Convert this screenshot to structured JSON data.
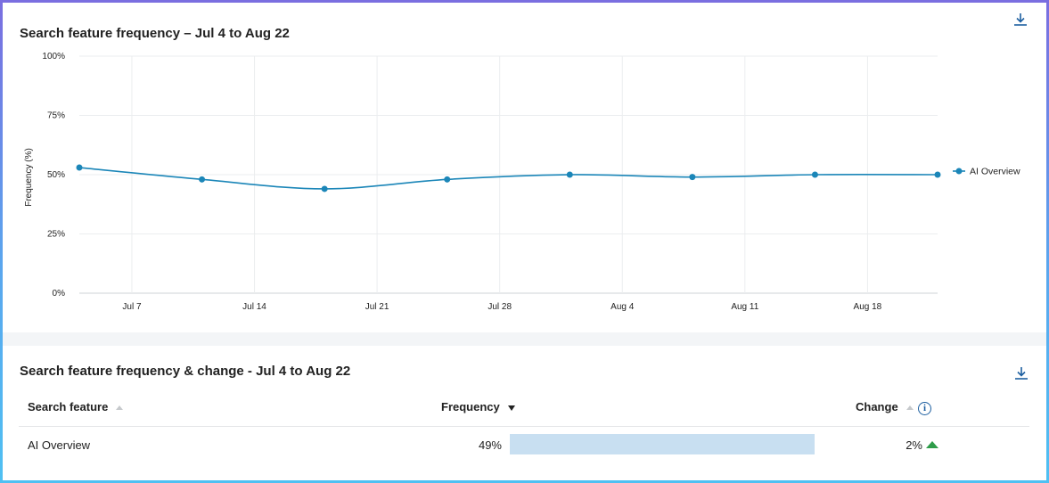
{
  "chart_panel": {
    "title": "Search feature frequency – Jul 4 to Aug 22",
    "download_icon": "download-icon"
  },
  "chart_data": {
    "type": "line",
    "title": "Search feature frequency – Jul 4 to Aug 22",
    "xlabel": "",
    "ylabel": "Frequency (%)",
    "ylim": [
      0,
      100
    ],
    "y_ticks": [
      0,
      25,
      50,
      75,
      100
    ],
    "y_tick_labels": [
      "0%",
      "25%",
      "50%",
      "75%",
      "100%"
    ],
    "x_range": [
      "2024-07-04",
      "2024-08-22"
    ],
    "x_ticks": [
      "2024-07-07",
      "2024-07-14",
      "2024-07-21",
      "2024-07-28",
      "2024-08-04",
      "2024-08-11",
      "2024-08-18"
    ],
    "x_tick_labels": [
      "Jul 7",
      "Jul 14",
      "Jul 21",
      "Jul 28",
      "Aug 4",
      "Aug 11",
      "Aug 18"
    ],
    "grid": true,
    "legend_position": "right",
    "series": [
      {
        "name": "AI Overview",
        "color": "#1b86b8",
        "x": [
          "2024-07-04",
          "2024-07-11",
          "2024-07-18",
          "2024-07-25",
          "2024-08-01",
          "2024-08-08",
          "2024-08-15",
          "2024-08-22"
        ],
        "values": [
          53,
          48,
          44,
          48,
          50,
          49,
          50,
          50
        ]
      }
    ]
  },
  "table_panel": {
    "title": "Search feature frequency & change - Jul 4 to Aug 22",
    "download_icon": "download-icon",
    "columns": {
      "feature": "Search feature",
      "frequency": "Frequency",
      "change": "Change"
    },
    "info_icon": "info-icon",
    "info_glyph": "i",
    "rows": [
      {
        "feature": "AI Overview",
        "frequency": "49%",
        "frequency_value": 49,
        "change": "2%",
        "change_direction": "up"
      }
    ],
    "bar_color": "#c8dff1",
    "up_color": "#2e9c49"
  }
}
